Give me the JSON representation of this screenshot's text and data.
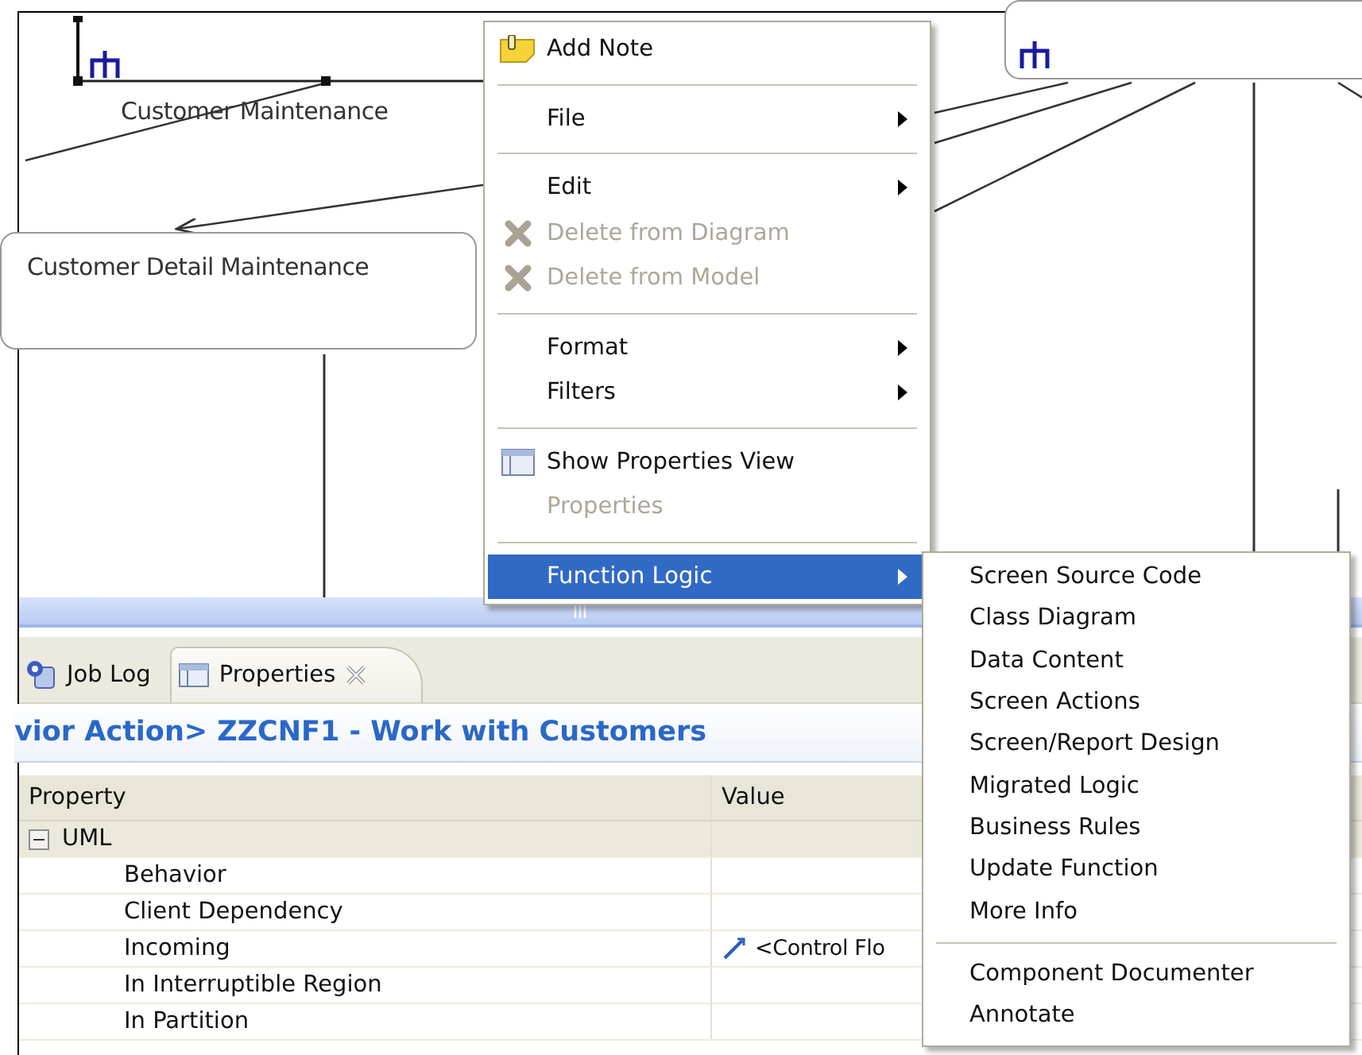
{
  "diagram": {
    "nodes": [
      {
        "label": "Customer Maintenance",
        "selected": true
      },
      {
        "label": "Customer Detail Maintenance",
        "selected": false
      }
    ]
  },
  "context_menu": {
    "items": [
      {
        "kind": "note",
        "label": "Add Note",
        "submenu": false,
        "disabled": false,
        "selected": false
      },
      {
        "kind": "separator"
      },
      {
        "kind": "plain",
        "label": "File",
        "submenu": true,
        "disabled": false,
        "selected": false
      },
      {
        "kind": "separator"
      },
      {
        "kind": "plain",
        "label": "Edit",
        "submenu": true,
        "disabled": false,
        "selected": false
      },
      {
        "kind": "delete",
        "label": "Delete from Diagram",
        "submenu": false,
        "disabled": true,
        "selected": false
      },
      {
        "kind": "delete",
        "label": "Delete from Model",
        "submenu": false,
        "disabled": true,
        "selected": false
      },
      {
        "kind": "separator"
      },
      {
        "kind": "plain",
        "label": "Format",
        "submenu": true,
        "disabled": false,
        "selected": false
      },
      {
        "kind": "plain",
        "label": "Filters",
        "submenu": true,
        "disabled": false,
        "selected": false
      },
      {
        "kind": "separator"
      },
      {
        "kind": "panel",
        "label": "Show Properties View",
        "submenu": false,
        "disabled": false,
        "selected": false
      },
      {
        "kind": "plain",
        "label": "Properties",
        "submenu": false,
        "disabled": true,
        "selected": false
      },
      {
        "kind": "separator"
      },
      {
        "kind": "plain",
        "label": "Function Logic",
        "submenu": true,
        "disabled": false,
        "selected": true
      }
    ]
  },
  "submenu": {
    "items": [
      {
        "kind": "item",
        "label": "Screen Source Code"
      },
      {
        "kind": "item",
        "label": "Class Diagram"
      },
      {
        "kind": "item",
        "label": "Data Content"
      },
      {
        "kind": "item",
        "label": "Screen Actions"
      },
      {
        "kind": "item",
        "label": "Screen/Report Design"
      },
      {
        "kind": "item",
        "label": "Migrated Logic"
      },
      {
        "kind": "item",
        "label": "Business Rules"
      },
      {
        "kind": "item",
        "label": "Update Function"
      },
      {
        "kind": "item",
        "label": "More Info"
      },
      {
        "kind": "separator"
      },
      {
        "kind": "item",
        "label": "Component Documenter"
      },
      {
        "kind": "item",
        "label": "Annotate"
      }
    ]
  },
  "tabs": [
    {
      "kind": "log",
      "label": "Job Log",
      "selected": false,
      "closable": false
    },
    {
      "kind": "panel",
      "label": "Properties",
      "selected": true,
      "closable": true
    }
  ],
  "properties": {
    "title": "vior Action> ZZCNF1 - Work with Customers",
    "columns": [
      "Property",
      "Value"
    ],
    "group": {
      "label": "UML",
      "expanded": true
    },
    "rows": [
      {
        "property": "Behavior"
      },
      {
        "property": "Client Dependency"
      },
      {
        "property": "Incoming",
        "value": "<Control Flo"
      },
      {
        "property": "In Interruptible Region"
      },
      {
        "property": "In Partition"
      }
    ]
  }
}
